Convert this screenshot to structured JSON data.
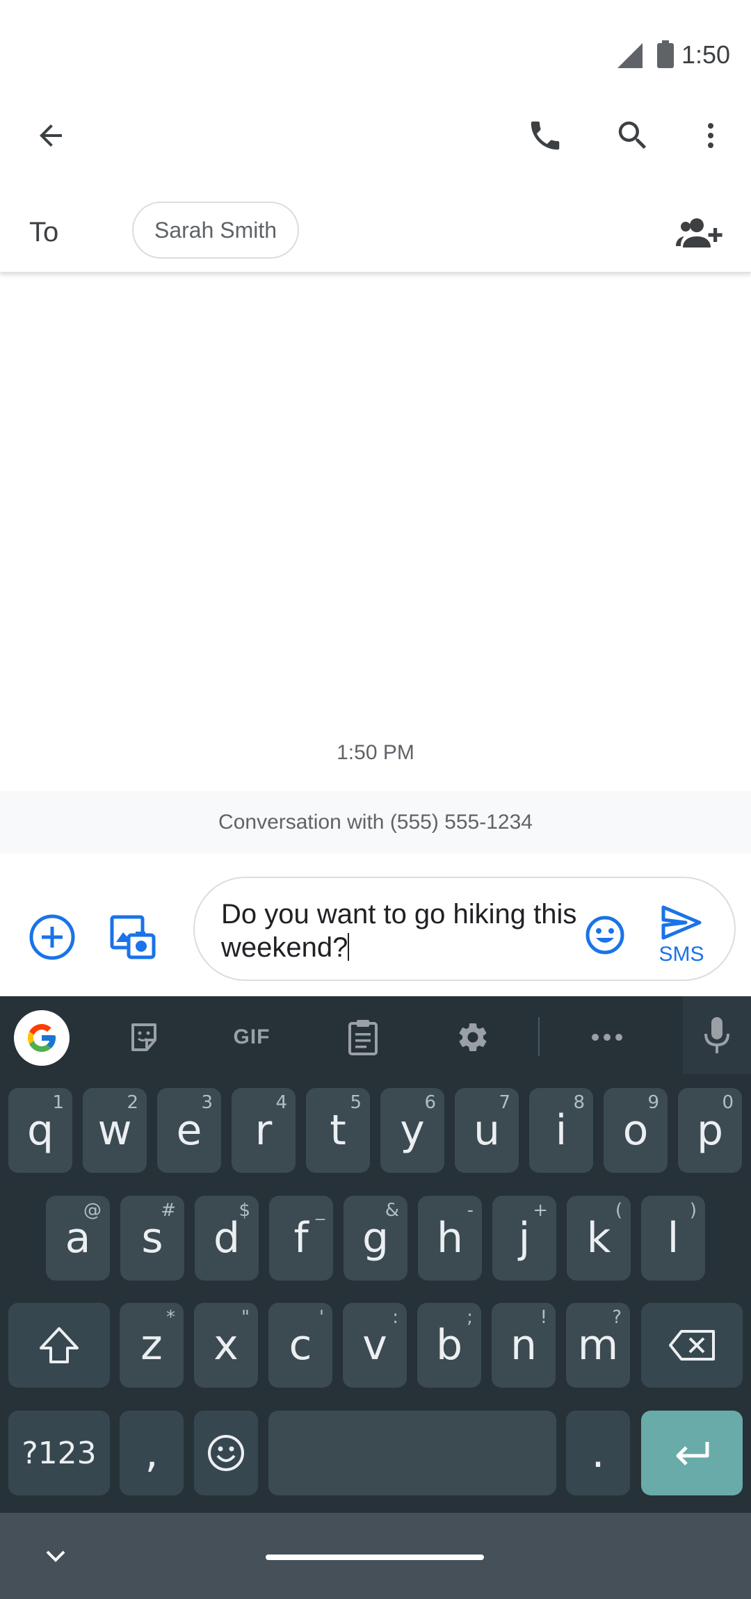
{
  "status_bar": {
    "time": "1:50"
  },
  "app_bar": {
    "icons": {
      "back": "arrow-back-icon",
      "call": "phone-icon",
      "search": "search-icon",
      "more": "more-vert-icon"
    }
  },
  "recipients": {
    "to_label": "To",
    "chip": "Sarah Smith",
    "add_icon": "add-person-icon"
  },
  "conversation": {
    "timestamp": "1:50 PM",
    "banner": "Conversation with (555) 555-1234"
  },
  "compose": {
    "text": "Do you want to go hiking this weekend?",
    "send_label": "SMS",
    "accent_color": "#1a73e8"
  },
  "keyboard": {
    "toolbar": {
      "gif_label": "GIF",
      "icons": [
        "google-icon",
        "sticker-icon",
        "gif-icon",
        "clipboard-icon",
        "settings-icon",
        "more-horiz-icon",
        "mic-icon"
      ]
    },
    "row1": [
      {
        "key": "q",
        "hint": "1"
      },
      {
        "key": "w",
        "hint": "2"
      },
      {
        "key": "e",
        "hint": "3"
      },
      {
        "key": "r",
        "hint": "4"
      },
      {
        "key": "t",
        "hint": "5"
      },
      {
        "key": "y",
        "hint": "6"
      },
      {
        "key": "u",
        "hint": "7"
      },
      {
        "key": "i",
        "hint": "8"
      },
      {
        "key": "o",
        "hint": "9"
      },
      {
        "key": "p",
        "hint": "0"
      }
    ],
    "row2": [
      {
        "key": "a",
        "hint": "@"
      },
      {
        "key": "s",
        "hint": "#"
      },
      {
        "key": "d",
        "hint": "$"
      },
      {
        "key": "f",
        "hint": "_"
      },
      {
        "key": "g",
        "hint": "&"
      },
      {
        "key": "h",
        "hint": "-"
      },
      {
        "key": "j",
        "hint": "+"
      },
      {
        "key": "k",
        "hint": "("
      },
      {
        "key": "l",
        "hint": ")"
      }
    ],
    "row3": [
      {
        "key": "z",
        "hint": "*"
      },
      {
        "key": "x",
        "hint": "\""
      },
      {
        "key": "c",
        "hint": "'"
      },
      {
        "key": "v",
        "hint": ":"
      },
      {
        "key": "b",
        "hint": ";"
      },
      {
        "key": "n",
        "hint": "!"
      },
      {
        "key": "m",
        "hint": "?"
      }
    ],
    "row4": {
      "symbols": "?123",
      "comma": ",",
      "period": "."
    },
    "enter_color": "#69aba9"
  }
}
